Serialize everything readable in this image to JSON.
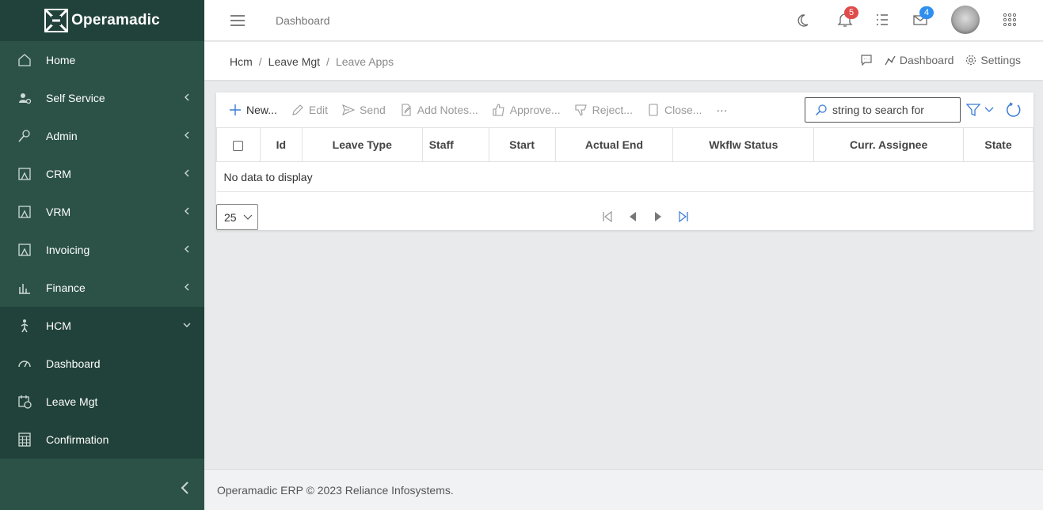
{
  "brand": {
    "name": "Operamadic"
  },
  "sidebar": {
    "items": [
      {
        "label": "Home",
        "icon": "home-icon",
        "has_children": false
      },
      {
        "label": "Self Service",
        "icon": "user-gear-icon",
        "has_children": true
      },
      {
        "label": "Admin",
        "icon": "key-icon",
        "has_children": true
      },
      {
        "label": "CRM",
        "icon": "frame-icon",
        "has_children": true
      },
      {
        "label": "VRM",
        "icon": "frame-icon",
        "has_children": true
      },
      {
        "label": "Invoicing",
        "icon": "frame-icon",
        "has_children": true
      },
      {
        "label": "Finance",
        "icon": "chart-icon",
        "has_children": true
      },
      {
        "label": "HCM",
        "icon": "person-walk-icon",
        "has_children": true,
        "expanded": true
      },
      {
        "label": "Dashboard",
        "icon": "gauge-icon",
        "sub": true
      },
      {
        "label": "Leave Mgt",
        "icon": "calendar-clock-icon",
        "sub": true
      },
      {
        "label": "Confirmation",
        "icon": "calculator-icon",
        "sub": true
      }
    ]
  },
  "header": {
    "title": "Dashboard",
    "notifications_count": "5",
    "messages_count": "4",
    "colors": {
      "notif_badge": "#e04b4b",
      "msg_badge": "#2f8ff0"
    }
  },
  "breadcrumb": {
    "items": [
      "Hcm",
      "Leave Mgt",
      "Leave Apps"
    ],
    "dashboard_label": "Dashboard",
    "settings_label": "Settings"
  },
  "toolbar": {
    "new_label": "New...",
    "edit_label": "Edit",
    "send_label": "Send",
    "add_notes_label": "Add Notes...",
    "approve_label": "Approve...",
    "reject_label": "Reject...",
    "close_label": "Close...",
    "more_label": "···"
  },
  "search": {
    "value": "",
    "placeholder": "string to search for"
  },
  "grid": {
    "columns": [
      "Id",
      "Leave Type",
      "Staff",
      "Start",
      "Actual End",
      "Wkflw Status",
      "Curr. Assignee",
      "State"
    ],
    "empty_text": "No data to display",
    "page_size": "25"
  },
  "footer": {
    "text": "Operamadic ERP © 2023 Reliance Infosystems."
  },
  "colors": {
    "sidebar_bg": "#2c5248",
    "sidebar_dark": "#21423a",
    "accent": "#3a7bd5"
  }
}
